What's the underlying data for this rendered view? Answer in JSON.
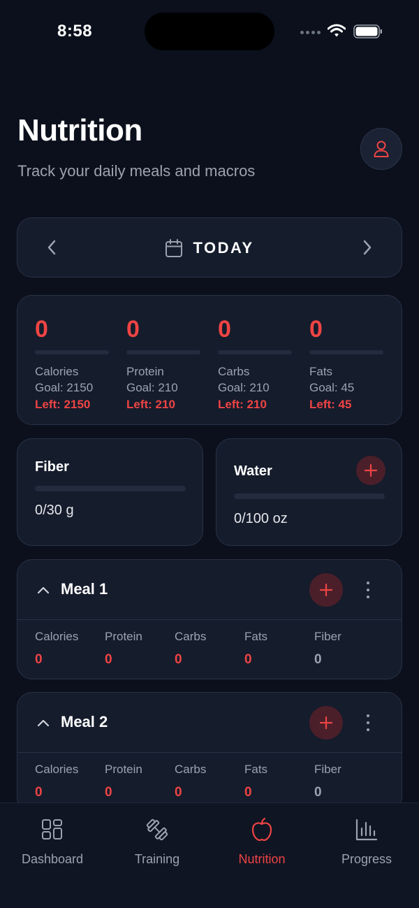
{
  "status_bar": {
    "time": "8:58"
  },
  "header": {
    "title": "Nutrition",
    "subtitle": "Track your daily meals and macros",
    "profile_icon": "user-icon"
  },
  "date_nav": {
    "label": "TODAY",
    "prev_icon": "chevron-left-icon",
    "next_icon": "chevron-right-icon",
    "calendar_icon": "calendar-icon"
  },
  "macros": [
    {
      "value": "0",
      "name": "Calories",
      "goal": "Goal: 2150",
      "left": "Left: 2150",
      "progress": 0
    },
    {
      "value": "0",
      "name": "Protein",
      "goal": "Goal: 210",
      "left": "Left: 210",
      "progress": 0
    },
    {
      "value": "0",
      "name": "Carbs",
      "goal": "Goal: 210",
      "left": "Left: 210",
      "progress": 0
    },
    {
      "value": "0",
      "name": "Fats",
      "goal": "Goal: 45",
      "left": "Left: 45",
      "progress": 0
    }
  ],
  "fiber": {
    "title": "Fiber",
    "value": "0/30 g",
    "progress": 0
  },
  "water": {
    "title": "Water",
    "value": "0/100 oz",
    "progress": 0,
    "add_icon": "plus-icon"
  },
  "meals": [
    {
      "title": "Meal 1",
      "stats": [
        {
          "label": "Calories",
          "value": "0"
        },
        {
          "label": "Protein",
          "value": "0"
        },
        {
          "label": "Carbs",
          "value": "0"
        },
        {
          "label": "Fats",
          "value": "0"
        },
        {
          "label": "Fiber",
          "value": "0"
        }
      ]
    },
    {
      "title": "Meal 2",
      "stats": [
        {
          "label": "Calories",
          "value": "0"
        },
        {
          "label": "Protein",
          "value": "0"
        },
        {
          "label": "Carbs",
          "value": "0"
        },
        {
          "label": "Fats",
          "value": "0"
        },
        {
          "label": "Fiber",
          "value": "0"
        }
      ]
    }
  ],
  "tabs": [
    {
      "label": "Dashboard",
      "icon": "grid-icon",
      "active": false
    },
    {
      "label": "Training",
      "icon": "dumbbell-icon",
      "active": false
    },
    {
      "label": "Nutrition",
      "icon": "apple-icon",
      "active": true
    },
    {
      "label": "Progress",
      "icon": "bar-chart-icon",
      "active": false
    }
  ],
  "colors": {
    "background": "#0b101c",
    "card": "#151c2c",
    "accent": "#ef4444",
    "muted_text": "#9ca3af"
  }
}
